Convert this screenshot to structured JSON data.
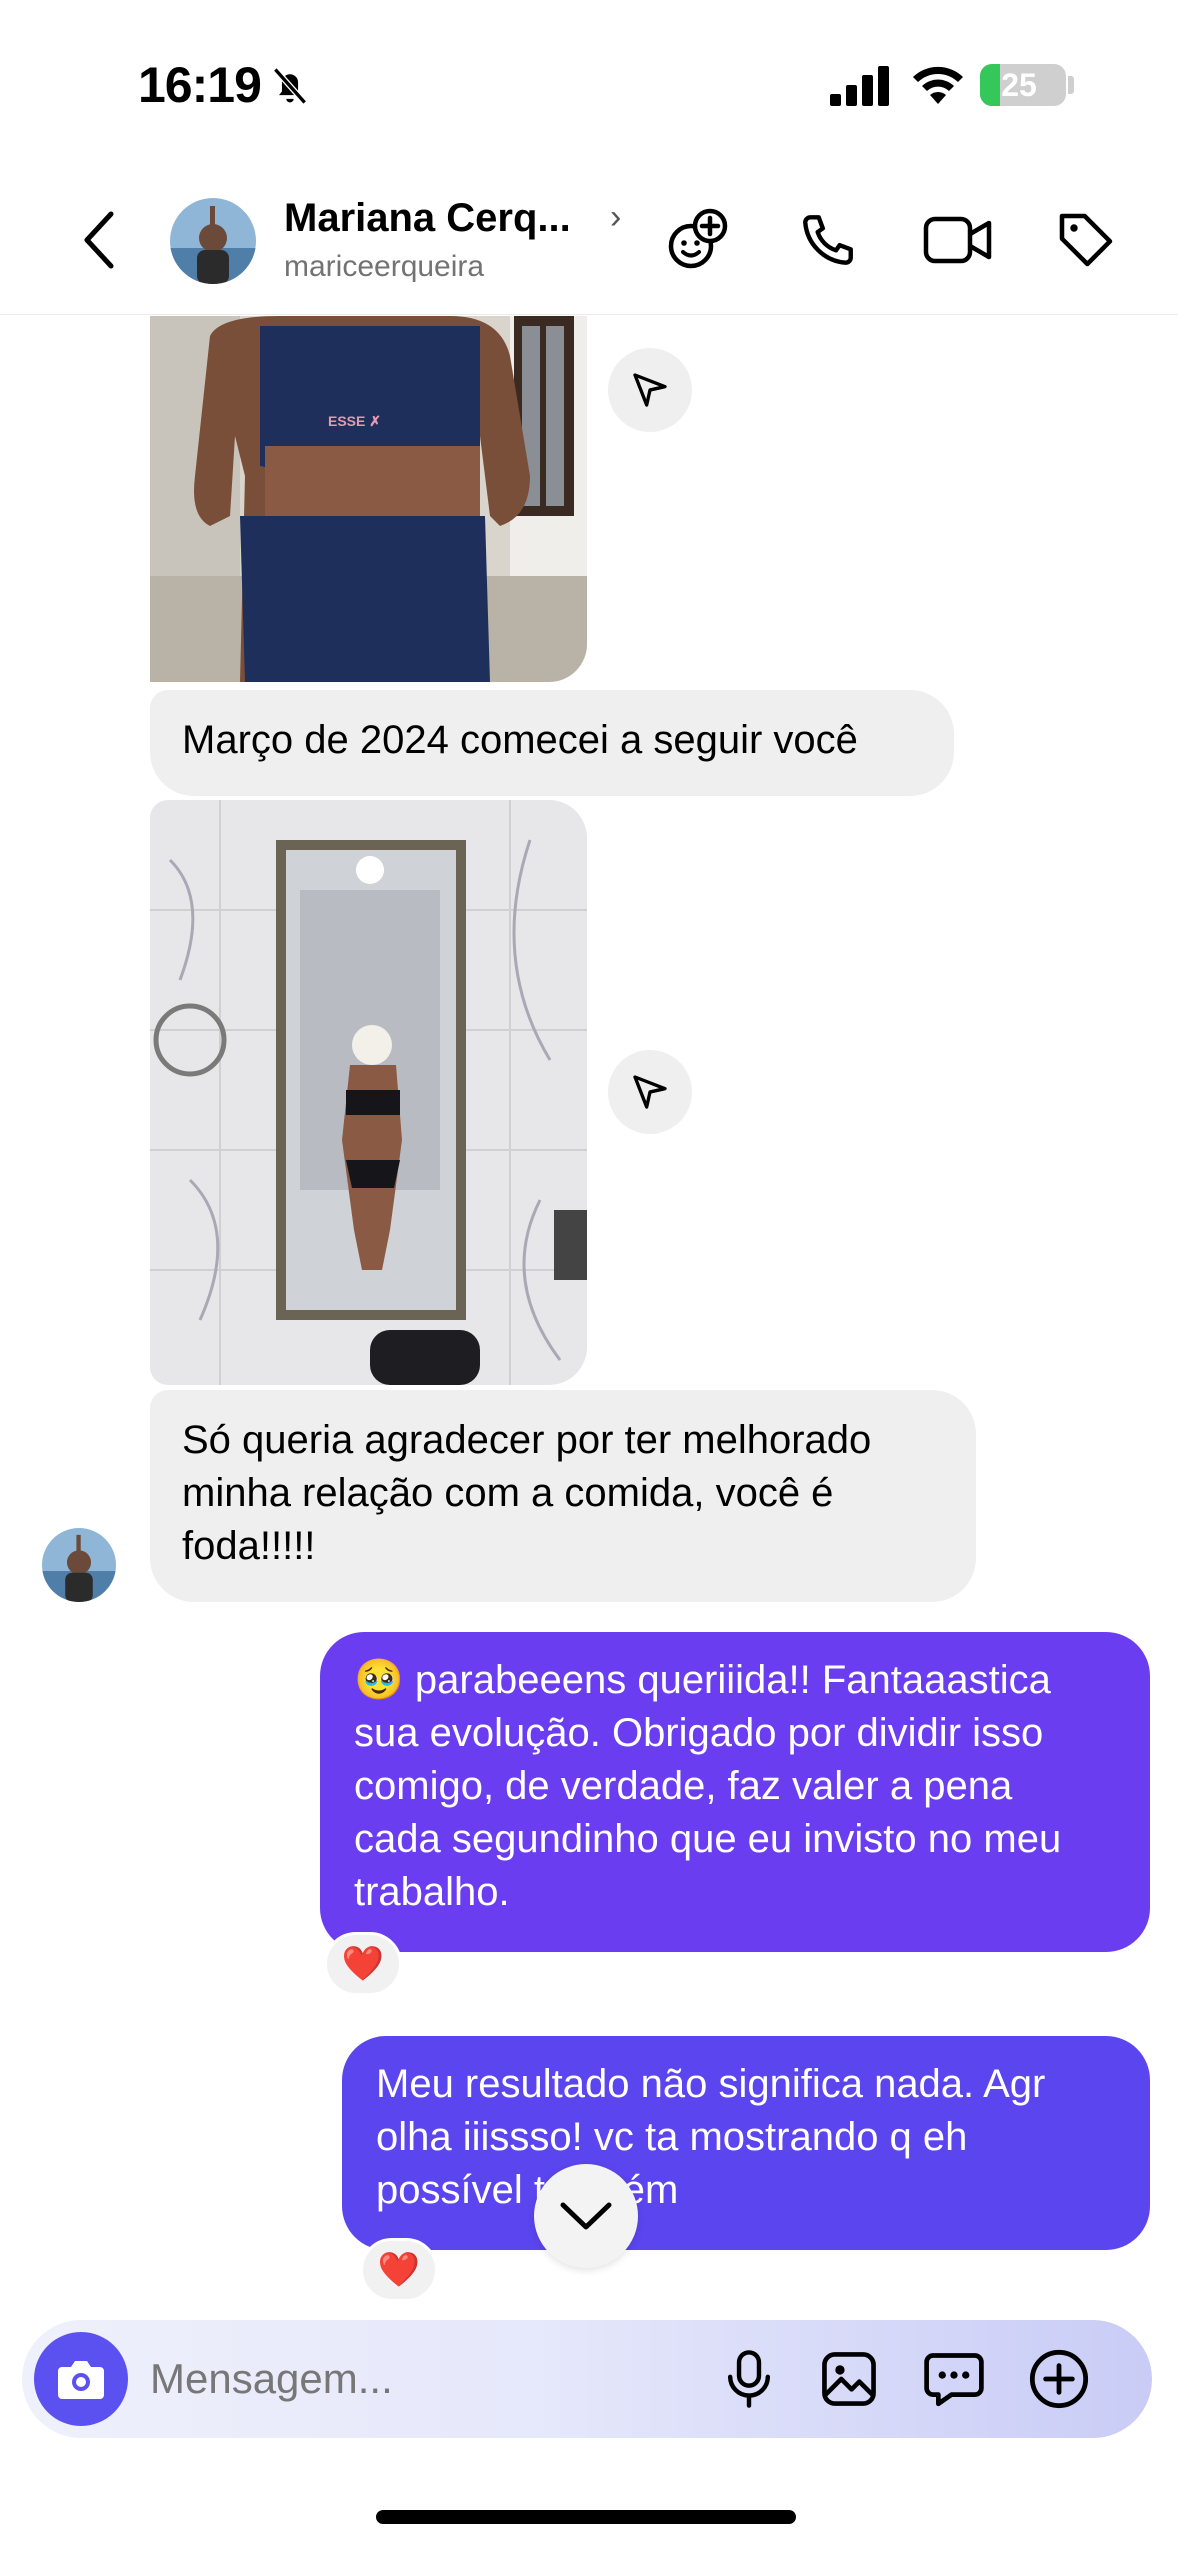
{
  "status_bar": {
    "time": "16:19",
    "battery": "25",
    "battery_level": 0.25,
    "icons": [
      "bell-slash-icon",
      "cellular-signal-icon",
      "wifi-icon",
      "battery-charging-icon"
    ]
  },
  "header": {
    "contact_name": "Mariana Cerq...",
    "username": "mariceerqueira",
    "chevron": "›",
    "icons": [
      "back-arrow-icon",
      "add-effect-icon",
      "phone-icon",
      "video-camera-icon",
      "tag-icon"
    ]
  },
  "messages": {
    "incoming_1": "Março de 2024 comecei a seguir você",
    "incoming_2_lines": [
      "Só queria agradecer por ter melhorado",
      "minha relação com a comida, você é",
      "foda!!!!!"
    ],
    "outgoing_1_lines": [
      "🥹 parabeeens queriiida!! Fantaaastica",
      "sua evolução. Obrigado por dividir isso",
      "comigo, de verdade, faz valer a pena",
      "cada segundinho que eu invisto no meu",
      "trabalho."
    ],
    "outgoing_2_lines": [
      "Meu resultado não significa nada. Agr",
      "olha iiissso! vc ta mostrando q eh",
      "possível também"
    ],
    "reaction_emoji": "❤️"
  },
  "colors": {
    "outgoing_bubble_1": "#6a3df0",
    "outgoing_bubble_2": "#5b45ef",
    "incoming_bubble": "#efeff0",
    "accent": "#5b51f0"
  },
  "composer": {
    "placeholder": "Mensagem...",
    "icons": [
      "camera-icon",
      "microphone-icon",
      "gallery-icon",
      "sticker-chat-icon",
      "plus-circle-icon"
    ]
  }
}
